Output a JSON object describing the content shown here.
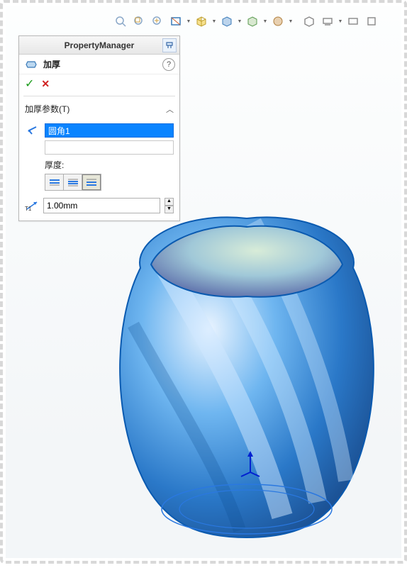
{
  "panel": {
    "title": "PropertyManager",
    "feature_label": "加厚",
    "help_symbol": "?",
    "ok_symbol": "✓",
    "cancel_symbol": "✕"
  },
  "group": {
    "header": "加厚参数(T)",
    "selection_value": "圆角1",
    "thickness_label": "厚度:",
    "dim_value": "1.00mm"
  },
  "toolbar": {
    "tips": [
      "zoom-fit",
      "zoom-area",
      "zoom-prev",
      "section",
      "view-orient",
      "display-style",
      "hide-show",
      "edit-appearance",
      "scene",
      "view-settings",
      "render",
      "full-screen"
    ]
  }
}
